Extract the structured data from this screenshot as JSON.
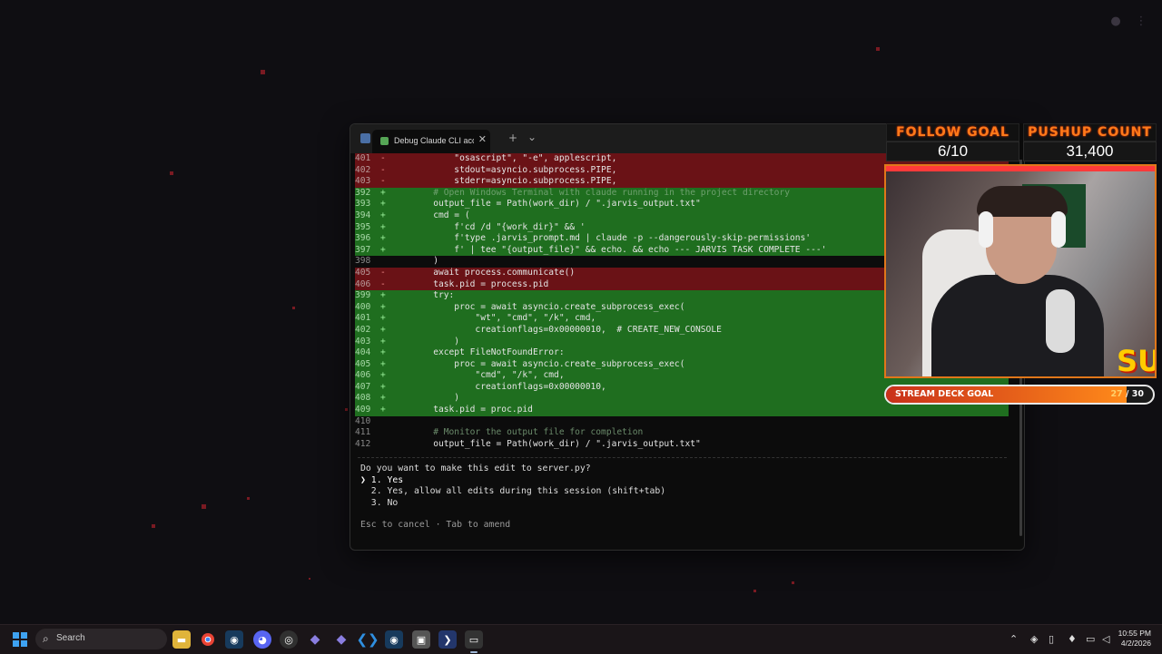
{
  "terminal": {
    "tab_label": "Debug Claude CLI access p",
    "new_tab_symbol": "+",
    "dropdown_symbol": "⌄",
    "close_symbol": "✕",
    "diff_lines": [
      {
        "type": "del",
        "num": "401",
        "marker": "-",
        "code": "            \"osascript\", \"-e\", applescript,"
      },
      {
        "type": "del",
        "num": "402",
        "marker": "-",
        "code": "            stdout=asyncio.subprocess.PIPE,"
      },
      {
        "type": "del",
        "num": "403",
        "marker": "-",
        "code": "            stderr=asyncio.subprocess.PIPE,"
      },
      {
        "type": "add",
        "num": "392",
        "marker": "+",
        "code": "        # Open Windows Terminal with claude running in the project directory",
        "comment": true
      },
      {
        "type": "add",
        "num": "393",
        "marker": "+",
        "code": "        output_file = Path(work_dir) / \".jarvis_output.txt\""
      },
      {
        "type": "add",
        "num": "394",
        "marker": "+",
        "code": "        cmd = ("
      },
      {
        "type": "add",
        "num": "395",
        "marker": "+",
        "code": "            f'cd /d \"{work_dir}\" && '"
      },
      {
        "type": "add",
        "num": "396",
        "marker": "+",
        "code": "            f'type .jarvis_prompt.md | claude -p --dangerously-skip-permissions'"
      },
      {
        "type": "add",
        "num": "397",
        "marker": "+",
        "code": "            f' | tee \"{output_file}\" && echo. && echo --- JARVIS TASK COMPLETE ---'"
      },
      {
        "type": "ctx",
        "num": "398",
        "marker": " ",
        "code": "        )"
      },
      {
        "type": "del",
        "num": "405",
        "marker": "-",
        "code": "        await process.communicate()"
      },
      {
        "type": "del",
        "num": "406",
        "marker": "-",
        "code": "        task.pid = process.pid"
      },
      {
        "type": "add",
        "num": "399",
        "marker": "+",
        "code": "        try:"
      },
      {
        "type": "add",
        "num": "400",
        "marker": "+",
        "code": "            proc = await asyncio.create_subprocess_exec("
      },
      {
        "type": "add",
        "num": "401",
        "marker": "+",
        "code": "                \"wt\", \"cmd\", \"/k\", cmd,"
      },
      {
        "type": "add",
        "num": "402",
        "marker": "+",
        "code": "                creationflags=0x00000010,  # CREATE_NEW_CONSOLE"
      },
      {
        "type": "add",
        "num": "403",
        "marker": "+",
        "code": "            )"
      },
      {
        "type": "add",
        "num": "404",
        "marker": "+",
        "code": "        except FileNotFoundError:"
      },
      {
        "type": "add",
        "num": "405",
        "marker": "+",
        "code": "            proc = await asyncio.create_subprocess_exec("
      },
      {
        "type": "add",
        "num": "406",
        "marker": "+",
        "code": "                \"cmd\", \"/k\", cmd,"
      },
      {
        "type": "add",
        "num": "407",
        "marker": "+",
        "code": "                creationflags=0x00000010,"
      },
      {
        "type": "add",
        "num": "408",
        "marker": "+",
        "code": "            )"
      },
      {
        "type": "add",
        "num": "409",
        "marker": "+",
        "code": "        task.pid = proc.pid"
      },
      {
        "type": "ctx",
        "num": "410",
        "marker": " ",
        "code": ""
      },
      {
        "type": "ctx",
        "num": "411",
        "marker": " ",
        "code": "        # Monitor the output file for completion",
        "comment": true
      },
      {
        "type": "ctx",
        "num": "412",
        "marker": " ",
        "code": "        output_file = Path(work_dir) / \".jarvis_output.txt\""
      }
    ],
    "question": "Do you want to make this edit to server.py?",
    "options": [
      {
        "text": "❯ 1. Yes",
        "selected": true
      },
      {
        "text": "  2. Yes, allow all edits during this session (shift+tab)",
        "selected": false
      },
      {
        "text": "  3. No",
        "selected": false
      }
    ],
    "hint": "Esc to cancel · Tab to amend"
  },
  "overlay": {
    "follow_goal_title": "FOLLOW GOAL",
    "follow_goal_value": "6/10",
    "pushup_title": "PUSHUP COUNT",
    "pushup_value": "31,400",
    "stream_deck_label": "STREAM DECK GOAL",
    "stream_deck_current": "27",
    "stream_deck_separator": " / ",
    "stream_deck_target": "30",
    "stream_deck_progress": 0.9,
    "cam_logo_text": "SU"
  },
  "taskbar": {
    "search_placeholder": "Search",
    "time": "10:55 PM",
    "date": "4/2/2026",
    "apps": [
      "windows-start",
      "file-explorer",
      "chrome",
      "steam",
      "discord",
      "obs",
      "app-diamond-1",
      "app-diamond-2",
      "vscode",
      "steam-2",
      "store",
      "powershell",
      "terminal"
    ]
  },
  "colors": {
    "accent": "#ff7a1a",
    "diff_deleted": "#6a1216",
    "diff_added": "#1f6e1f",
    "background": "#0f0e12"
  }
}
